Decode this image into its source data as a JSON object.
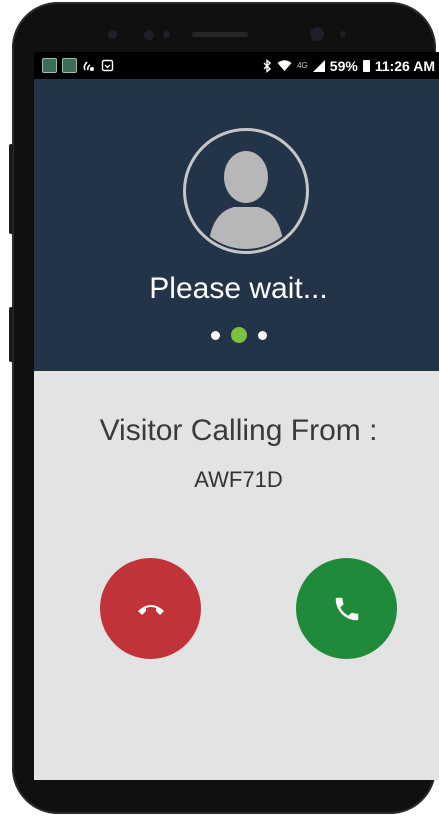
{
  "status_bar": {
    "left_icons": [
      "app-notification-icon",
      "app-notification-icon",
      "wifi-calling-icon",
      "screenshot-icon"
    ],
    "right_icons": [
      "bluetooth-icon",
      "wifi-icon",
      "lte-icon",
      "signal-icon",
      "battery-icon"
    ],
    "lte_label": "4G",
    "battery_percent": "59%",
    "time": "11:26 AM"
  },
  "call_screen": {
    "status_message": "Please wait...",
    "progress_dots": {
      "count": 3,
      "active_index": 1
    },
    "calling_label": "Visitor Calling From :",
    "visitor_id": "AWF71D"
  },
  "actions": {
    "decline_icon": "hang-up-icon",
    "accept_icon": "phone-icon"
  },
  "colors": {
    "header_bg": "#233348",
    "body_bg": "#e3e3e3",
    "accent_dot": "#7cc242",
    "decline": "#c13339",
    "accept": "#1e8a3a"
  }
}
